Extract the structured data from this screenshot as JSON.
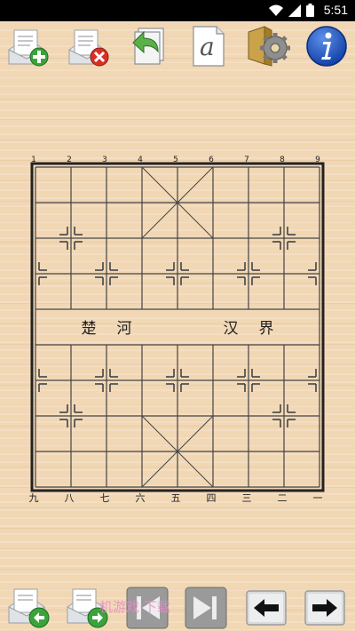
{
  "status_bar": {
    "time": "5:51",
    "icons": [
      "wifi-icon",
      "signal-icon",
      "battery-icon"
    ]
  },
  "toolbar": {
    "buttons": [
      {
        "name": "new-game-button",
        "icon": "document-add-icon"
      },
      {
        "name": "delete-game-button",
        "icon": "document-delete-icon"
      },
      {
        "name": "undo-button",
        "icon": "undo-document-icon"
      },
      {
        "name": "font-button",
        "icon": "font-a-icon"
      },
      {
        "name": "settings-button",
        "icon": "gear-icon"
      },
      {
        "name": "info-button",
        "icon": "info-icon"
      }
    ]
  },
  "board": {
    "top_labels": [
      "1",
      "2",
      "3",
      "4",
      "5",
      "6",
      "7",
      "8",
      "9"
    ],
    "bottom_labels": [
      "九",
      "八",
      "七",
      "六",
      "五",
      "四",
      "三",
      "二",
      "一"
    ],
    "river_left": [
      "楚",
      "河"
    ],
    "river_right": [
      "汉",
      "界"
    ]
  },
  "bottombar": {
    "buttons": [
      {
        "name": "previous-game-button",
        "icon": "document-back-icon"
      },
      {
        "name": "next-game-button",
        "icon": "document-forward-icon"
      },
      {
        "name": "first-move-button",
        "icon": "skip-to-start-icon"
      },
      {
        "name": "last-move-button",
        "icon": "skip-to-end-icon"
      },
      {
        "name": "step-back-button",
        "icon": "arrow-left-icon"
      },
      {
        "name": "step-forward-button",
        "icon": "arrow-right-icon"
      }
    ]
  },
  "watermark": {
    "text": "机游戏·下载"
  },
  "colors": {
    "background": "#f1d7b4",
    "grid_line": "#444444",
    "label_text": "#222222"
  }
}
